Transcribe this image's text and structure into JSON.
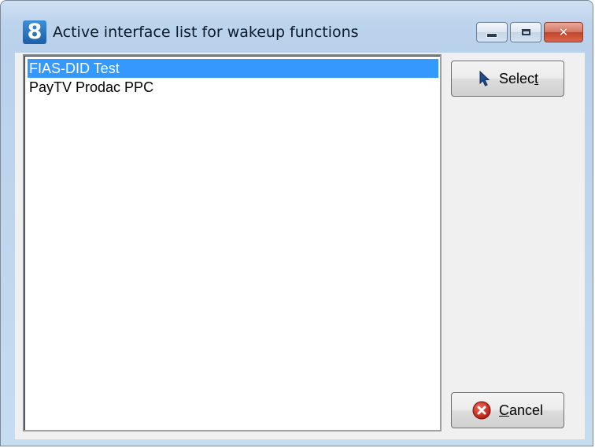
{
  "window": {
    "icon_glyph": "8",
    "title": "Active interface list for wakeup functions",
    "controls": {
      "minimize_icon": "minimize-icon",
      "maximize_icon": "maximize-icon",
      "close_icon": "close-icon",
      "close_glyph": "✕"
    }
  },
  "interface_list": {
    "items": [
      {
        "label": "FIAS-DID Test",
        "selected": true
      },
      {
        "label": "PayTV Prodac PPC",
        "selected": false
      }
    ],
    "selection_color": "#3399ff"
  },
  "buttons": {
    "select": {
      "label_pre": "Selec",
      "label_access": "t",
      "label_post": "",
      "icon": "cursor-arrow-icon"
    },
    "cancel": {
      "label_pre": "",
      "label_access": "C",
      "label_post": "ancel",
      "icon": "cancel-icon"
    }
  }
}
